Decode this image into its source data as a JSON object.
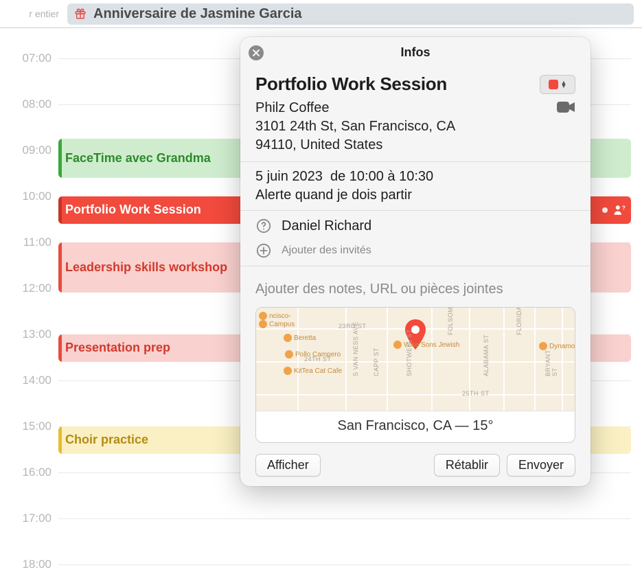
{
  "allday": {
    "label_truncated": "r entier",
    "event_title": "Anniversaire de Jasmine Garcia"
  },
  "timeline": {
    "hours": [
      "07:00",
      "08:00",
      "09:00",
      "10:00",
      "11:00",
      "12:00",
      "13:00",
      "14:00",
      "15:00",
      "16:00",
      "17:00",
      "18:00"
    ],
    "events": [
      {
        "id": "facetime",
        "title": "FaceTime avec Grandma",
        "color": "green",
        "start": "08:45",
        "end": "09:30"
      },
      {
        "id": "portfolio",
        "title": "Portfolio Work Session",
        "color": "red-solid",
        "start": "10:00",
        "end": "10:30",
        "has_invitee_badge": true
      },
      {
        "id": "leadership",
        "title": "Leadership skills workshop",
        "color": "red-light",
        "start": "11:00",
        "end": "12:00"
      },
      {
        "id": "presentation",
        "title": "Presentation prep",
        "color": "red-light",
        "start": "13:00",
        "end": "13:30"
      },
      {
        "id": "choir",
        "title": "Choir practice",
        "color": "yellow",
        "start": "15:00",
        "end": "15:30"
      }
    ]
  },
  "popover": {
    "header": "Infos",
    "title": "Portfolio Work Session",
    "calendar_color": "#f24a3d",
    "location_name": "Philz Coffee",
    "location_addr_line1": "3101 24th St, San Francisco, CA",
    "location_addr_line2": "94110, United States",
    "date_text": "5 juin 2023",
    "time_text": "de 10:00 à 10:30",
    "alert_text": "Alerte quand je dois partir",
    "invitees": [
      {
        "name": "Daniel Richard",
        "status": "unknown"
      }
    ],
    "add_invitees_placeholder": "Ajouter des invités",
    "notes_placeholder": "Ajouter des notes, URL ou pièces jointes",
    "map": {
      "caption": "San Francisco, CA — 15°",
      "pois": [
        "ncisco-",
        "Campus",
        "Beretta",
        "Pollo Campero",
        "KitTea Cat Cafe",
        "Wise Sons Jewish",
        "Dynamo Coffee"
      ],
      "streets": [
        "23RD ST",
        "24TH ST",
        "25TH ST",
        "S VAN NESS AVE",
        "CAPP ST",
        "SHOTWELL ST",
        "FOLSOM ST",
        "ALABAMA ST",
        "FLORIDA ST",
        "BRYANT ST"
      ]
    },
    "buttons": {
      "show": "Afficher",
      "revert": "Rétablir",
      "send": "Envoyer"
    }
  }
}
